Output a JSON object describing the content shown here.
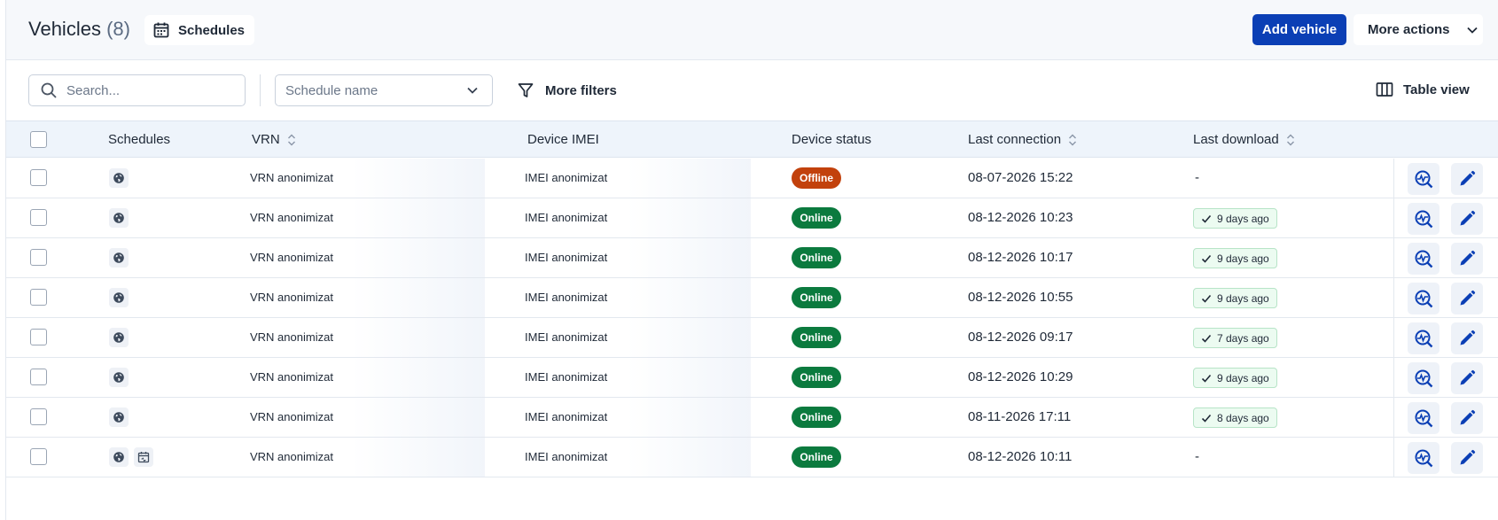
{
  "header": {
    "title": "Vehicles",
    "count": "(8)",
    "schedules_button": "Schedules",
    "add_vehicle": "Add vehicle",
    "more_actions": "More actions"
  },
  "toolbar": {
    "search_placeholder": "Search...",
    "schedule_placeholder": "Schedule name",
    "more_filters": "More filters",
    "table_view": "Table view"
  },
  "table": {
    "columns": {
      "schedules": "Schedules",
      "vrn": "VRN",
      "imei": "Device IMEI",
      "status": "Device status",
      "last_connection": "Last connection",
      "last_download": "Last download"
    },
    "rows": [
      {
        "vrn": "VRN anonimizat",
        "imei": "IMEI anonimizat",
        "status": "Offline",
        "connection": "08-07-2026 15:22",
        "download": "-"
      },
      {
        "vrn": "VRN anonimizat",
        "imei": "IMEI anonimizat",
        "status": "Online",
        "connection": "08-12-2026 10:23",
        "download": "9 days ago"
      },
      {
        "vrn": "VRN anonimizat",
        "imei": "IMEI anonimizat",
        "status": "Online",
        "connection": "08-12-2026 10:17",
        "download": "9 days ago"
      },
      {
        "vrn": "VRN anonimizat",
        "imei": "IMEI anonimizat",
        "status": "Online",
        "connection": "08-12-2026 10:55",
        "download": "9 days ago"
      },
      {
        "vrn": "VRN anonimizat",
        "imei": "IMEI anonimizat",
        "status": "Online",
        "connection": "08-12-2026 09:17",
        "download": "7 days ago"
      },
      {
        "vrn": "VRN anonimizat",
        "imei": "IMEI anonimizat",
        "status": "Online",
        "connection": "08-12-2026 10:29",
        "download": "9 days ago"
      },
      {
        "vrn": "VRN anonimizat",
        "imei": "IMEI anonimizat",
        "status": "Online",
        "connection": "08-11-2026 17:11",
        "download": "8 days ago"
      },
      {
        "vrn": "VRN anonimizat",
        "imei": "IMEI anonimizat",
        "status": "Online",
        "connection": "08-12-2026 10:11",
        "download": "-"
      }
    ]
  },
  "colors": {
    "primary": "#0b3fb5",
    "online": "#0b7a3e",
    "offline": "#c2410c",
    "header_bg": "#f6f8fb",
    "thead_bg": "#eef4fb"
  },
  "icons": {
    "schedules": "calendar-icon",
    "more_actions": "chevron-down-icon",
    "search": "search-icon",
    "filter": "filter-icon",
    "table_view": "columns-icon",
    "schedule_type": "globe-icon",
    "schedule_type_alt": "calendar-sync-icon",
    "row_action_1": "analytics-search-icon",
    "row_action_2": "edit-pencil-icon"
  }
}
